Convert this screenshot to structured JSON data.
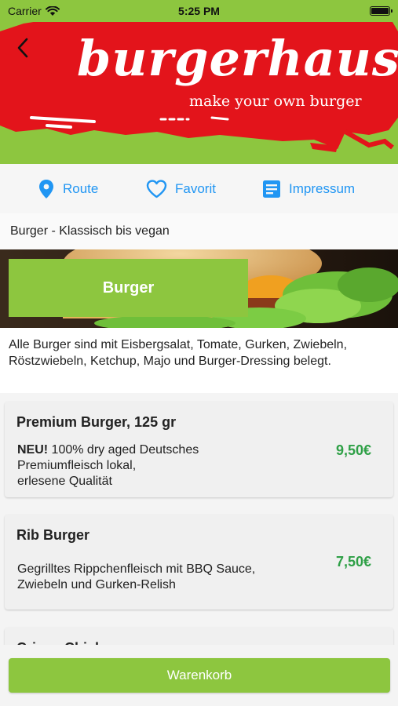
{
  "status_bar": {
    "carrier": "Carrier",
    "time": "5:25 PM",
    "icons": [
      "wifi-icon",
      "battery-icon"
    ]
  },
  "header": {
    "logo_title": "burgerhaus.",
    "logo_subtitle": "make your own burger",
    "back_icon": "chevron-left-icon"
  },
  "actions": [
    {
      "label": "Route",
      "icon": "location-pin-icon"
    },
    {
      "label": "Favorit",
      "icon": "heart-outline-icon"
    },
    {
      "label": "Impressum",
      "icon": "document-icon"
    }
  ],
  "section_title": "Burger - Klassisch bis vegan",
  "category": {
    "label": "Burger"
  },
  "category_description": "Alle Burger sind mit Eisbergsalat, Tomate, Gurken, Zwiebeln, Röstzwiebeln, Ketchup, Majo und Burger-Dressing belegt.",
  "items": [
    {
      "name": "Premium Burger, 125 gr",
      "badge": "NEU!",
      "line1": " 100% dry aged Deutsches",
      "line2": "Premiumfleisch lokal,",
      "line3": "erlesene Qualität",
      "price": "9,50€"
    },
    {
      "name": "Rib Burger",
      "line1": "Gegrilltes Rippchenfleisch mit BBQ Sauce,",
      "line2": "Zwiebeln und Gurken-Relish",
      "price": "7,50€"
    },
    {
      "name": "Crispy Chicken"
    }
  ],
  "cart_button": "Warenkorb",
  "colors": {
    "brand_green": "#8dc63f",
    "brand_red": "#e3141b",
    "link_blue": "#2196f3",
    "price_green": "#2fa047"
  }
}
